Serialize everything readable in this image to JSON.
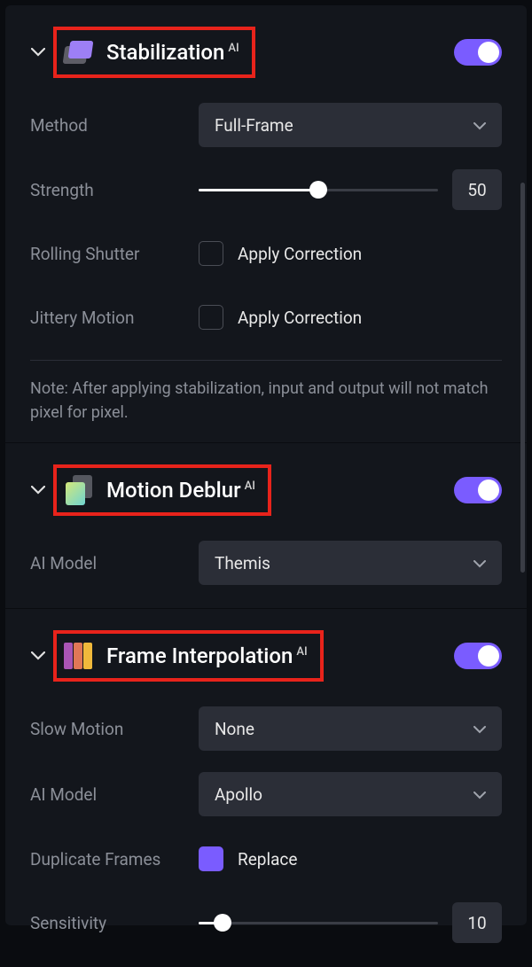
{
  "ai_badge": "AI",
  "stabilization": {
    "title": "Stabilization",
    "enabled": true,
    "method_label": "Method",
    "method_value": "Full-Frame",
    "strength_label": "Strength",
    "strength_value": "50",
    "strength_percent": 50,
    "rolling_shutter_label": "Rolling Shutter",
    "rolling_shutter_checkbox": "Apply Correction",
    "jittery_label": "Jittery Motion",
    "jittery_checkbox": "Apply Correction",
    "note": "Note: After applying stabilization, input and output will not match pixel for pixel."
  },
  "motion_deblur": {
    "title": "Motion Deblur",
    "enabled": true,
    "model_label": "AI Model",
    "model_value": "Themis"
  },
  "frame_interpolation": {
    "title": "Frame Interpolation",
    "enabled": true,
    "slow_motion_label": "Slow Motion",
    "slow_motion_value": "None",
    "model_label": "AI Model",
    "model_value": "Apollo",
    "duplicate_label": "Duplicate Frames",
    "duplicate_checkbox": "Replace",
    "sensitivity_label": "Sensitivity",
    "sensitivity_value": "10",
    "sensitivity_percent": 10
  }
}
